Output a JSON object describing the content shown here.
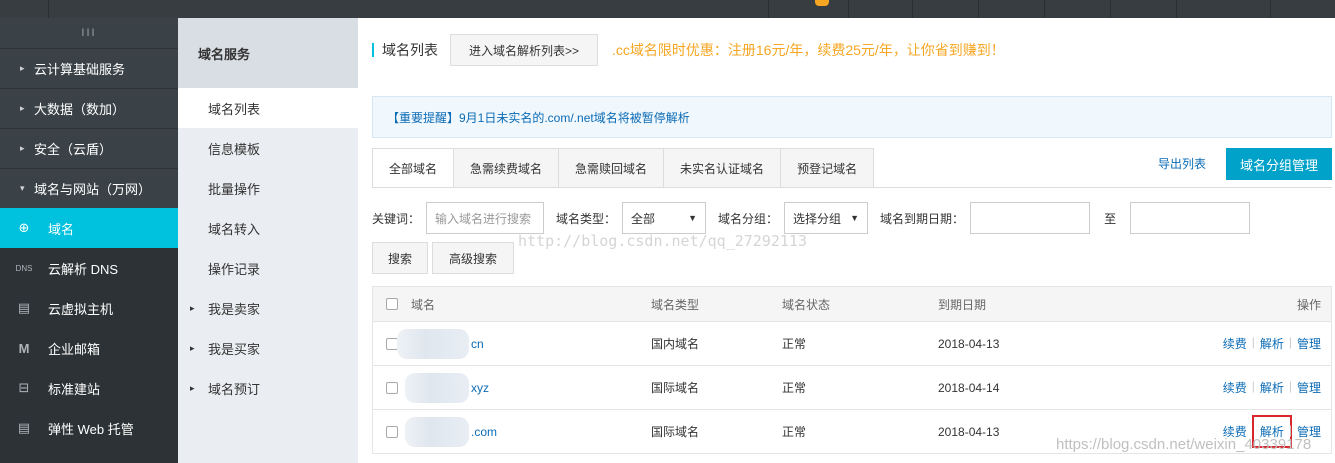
{
  "sidebar": {
    "toggle": "III",
    "groups": [
      {
        "label": "云计算基础服务",
        "caret": "▸"
      },
      {
        "label": "大数据（数加）",
        "caret": "▸"
      },
      {
        "label": "安全（云盾）",
        "caret": "▸"
      },
      {
        "label": "域名与网站（万网）",
        "caret": "▾"
      }
    ],
    "items": [
      {
        "label": "域名",
        "icon": "globe-icon",
        "glyph": "⊕"
      },
      {
        "label": "云解析 DNS",
        "icon": "dns-icon",
        "glyph": "DNS"
      },
      {
        "label": "云虚拟主机",
        "icon": "server-icon",
        "glyph": "▤"
      },
      {
        "label": "企业邮箱",
        "icon": "mail-icon",
        "glyph": "M"
      },
      {
        "label": "标准建站",
        "icon": "site-icon",
        "glyph": "⊟"
      },
      {
        "label": "弹性 Web 托管",
        "icon": "hosting-icon",
        "glyph": "▤"
      }
    ]
  },
  "subnav": {
    "title": "域名服务",
    "items": [
      {
        "label": "域名列表"
      },
      {
        "label": "信息模板"
      },
      {
        "label": "批量操作"
      },
      {
        "label": "域名转入"
      },
      {
        "label": "操作记录"
      },
      {
        "label": "我是卖家",
        "tri": "▸"
      },
      {
        "label": "我是买家",
        "tri": "▸"
      },
      {
        "label": "域名预订",
        "tri": "▸"
      }
    ]
  },
  "header": {
    "title": "域名列表",
    "enter_button": "进入域名解析列表>>",
    "promo": ".cc域名限时优惠：注册16元/年，续费25元/年，让你省到赚到！"
  },
  "notice": "【重要提醒】9月1日未实名的.com/.net域名将被暂停解析",
  "tabs": [
    "全部域名",
    "急需续费域名",
    "急需赎回域名",
    "未实名认证域名",
    "预登记域名"
  ],
  "export_label": "导出列表",
  "group_manage_label": "域名分组管理",
  "filter": {
    "keyword_label": "关键词：",
    "keyword_placeholder": "输入域名进行搜索",
    "type_label": "域名类型：",
    "type_value": "全部",
    "group_label": "域名分组：",
    "group_value": "选择分组",
    "expire_label": "域名到期日期：",
    "to_label": "至"
  },
  "buttons": {
    "search": "搜索",
    "advanced": "高级搜索"
  },
  "watermark": "http://blog.csdn.net/qq_27292113",
  "watermark2": "https://blog.csdn.net/weixin_40339178",
  "table": {
    "headers": [
      "域名",
      "域名类型",
      "域名状态",
      "到期日期",
      "操作"
    ],
    "rows": [
      {
        "suffix": "cn",
        "type": "国内域名",
        "status": "正常",
        "date": "2018-04-13",
        "renew": "续费",
        "resolve": "解析",
        "manage": "管理"
      },
      {
        "suffix": "xyz",
        "type": "国际域名",
        "status": "正常",
        "date": "2018-04-14",
        "renew": "续费",
        "resolve": "解析",
        "manage": "管理"
      },
      {
        "suffix": ".com",
        "type": "国际域名",
        "status": "正常",
        "date": "2018-04-13",
        "renew": "续费",
        "resolve": "解析",
        "manage": "管理"
      }
    ]
  },
  "colors": {
    "accent": "#00c1de",
    "link": "#0b6bb5",
    "promo": "#f6a623",
    "primary_button": "#00a2ca",
    "highlight": "#d9262c"
  }
}
